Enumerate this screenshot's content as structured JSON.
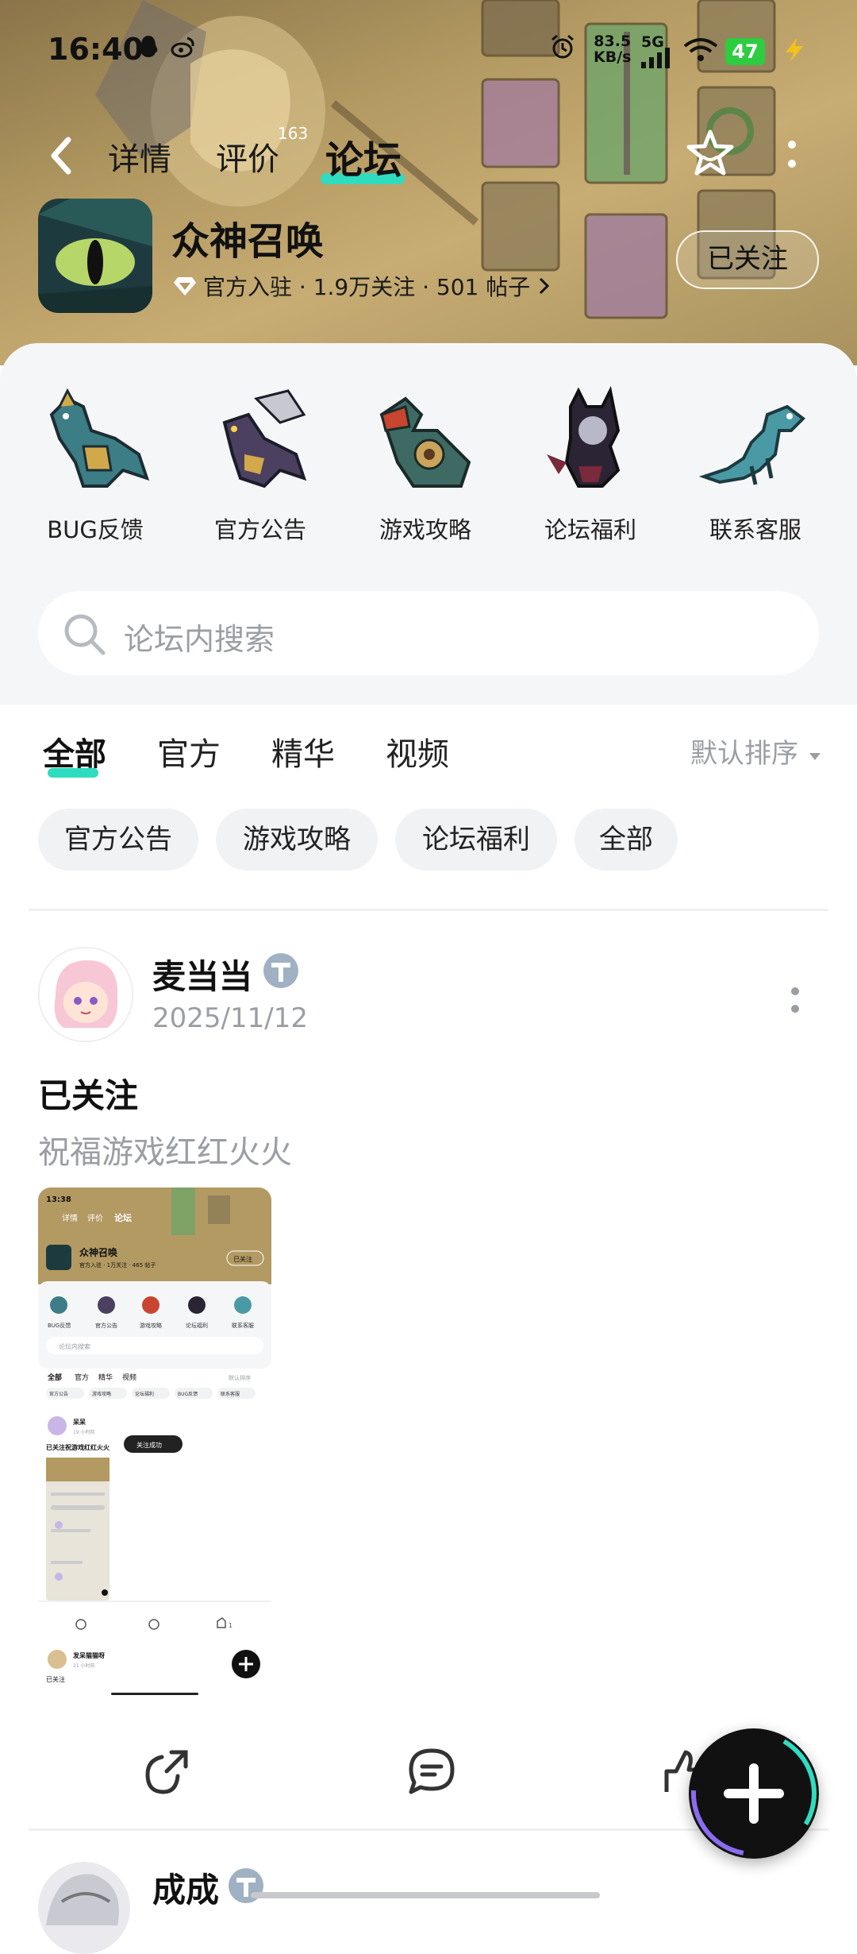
{
  "status": {
    "time": "16:40",
    "speed_value": "83.5",
    "speed_unit": "KB/s",
    "network": "5G",
    "battery": "47"
  },
  "nav": {
    "tabs": [
      {
        "label": "详情"
      },
      {
        "label": "评价",
        "badge": "163"
      },
      {
        "label": "论坛"
      }
    ],
    "active_tab": "论坛"
  },
  "app": {
    "name": "众神召唤",
    "meta": "官方入驻 · 1.9万关注 · 501 帖子",
    "follow_label": "已关注"
  },
  "categories": [
    {
      "label": "BUG反馈",
      "icon": "dragon-blue-icon"
    },
    {
      "label": "官方公告",
      "icon": "dragon-winged-icon"
    },
    {
      "label": "游戏攻略",
      "icon": "dragon-armored-icon"
    },
    {
      "label": "论坛福利",
      "icon": "dragon-dark-icon"
    },
    {
      "label": "联系客服",
      "icon": "dragon-teal-icon"
    }
  ],
  "search": {
    "placeholder": "论坛内搜索"
  },
  "filter_tabs": [
    {
      "label": "全部"
    },
    {
      "label": "官方"
    },
    {
      "label": "精华"
    },
    {
      "label": "视频"
    }
  ],
  "sort_label": "默认排序",
  "chips": [
    {
      "label": "官方公告"
    },
    {
      "label": "游戏攻略"
    },
    {
      "label": "论坛福利"
    },
    {
      "label": "全部"
    }
  ],
  "post": {
    "author": "麦当当",
    "date": "2025/11/12",
    "title": "已关注",
    "body": "祝福游戏红红火火",
    "screenshot": {
      "time": "13:38",
      "tabs": [
        "详情",
        "评价",
        "论坛"
      ],
      "app_name": "众神召唤",
      "meta": "官方入驻 · 1万关注 · 465 帖子",
      "follow": "已关注",
      "cats": [
        "BUG反馈",
        "官方公告",
        "游戏攻略",
        "论坛福利",
        "联系客服"
      ],
      "search": "论坛内搜索",
      "ftabs": [
        "全部",
        "官方",
        "精华",
        "视频"
      ],
      "sort": "默认排序",
      "chips": [
        "官方公告",
        "游戏攻略",
        "论坛福利",
        "BUG反馈",
        "联系客服"
      ],
      "author": "呆呆",
      "time_ago": "19 小时前",
      "text": "已关注祝游戏红红火火",
      "toast": "关注成功",
      "like_count": "1",
      "author2": "发呆猫猫呀",
      "time_ago2": "21 小时前",
      "text2": "已关注"
    }
  },
  "post2": {
    "author": "成成"
  }
}
